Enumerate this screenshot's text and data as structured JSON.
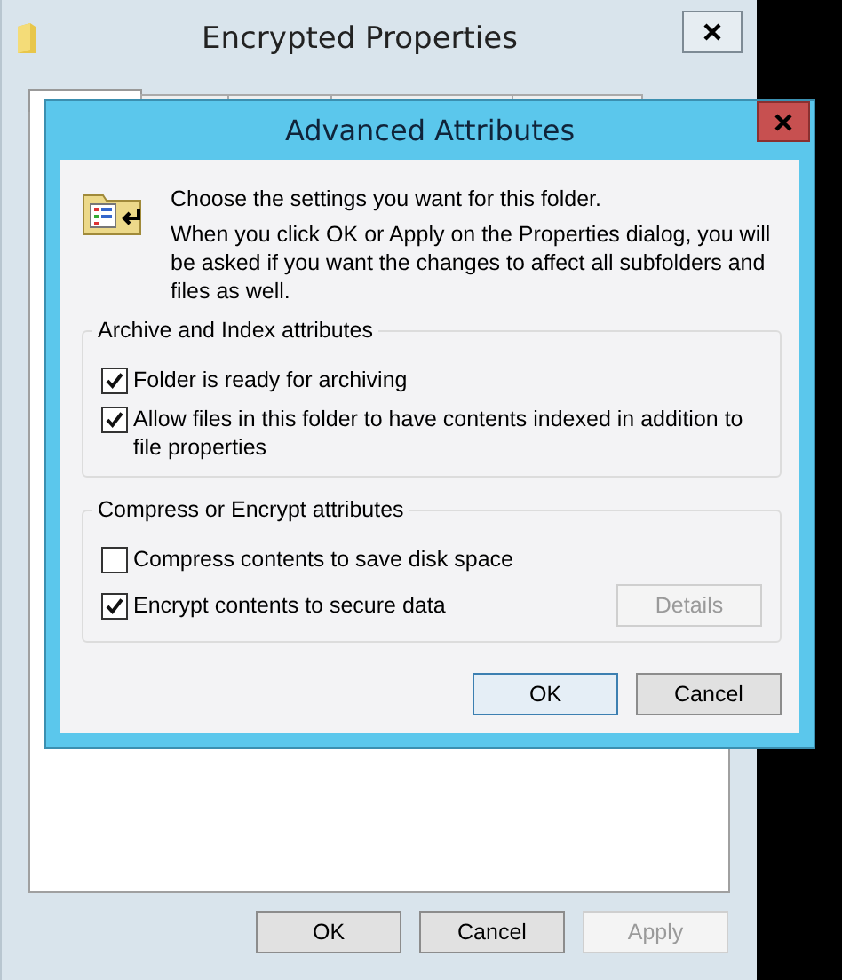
{
  "back_window": {
    "title": "Encrypted Properties",
    "buttons": [
      {
        "label": "OK",
        "disabled": false
      },
      {
        "label": "Cancel",
        "disabled": false
      },
      {
        "label": "Apply",
        "disabled": true
      }
    ]
  },
  "dialog": {
    "title": "Advanced Attributes",
    "intro": "Choose the settings you want for this folder.",
    "note": "When you click OK or Apply on the Properties dialog, you will be asked if you want the changes to affect all subfolders and files as well.",
    "groups": [
      {
        "title": "Archive and Index attributes",
        "options": [
          {
            "label": "Folder is ready for archiving",
            "checked": true
          },
          {
            "label": "Allow files in this folder to have contents indexed in addition to file properties",
            "checked": true
          }
        ]
      },
      {
        "title": "Compress or Encrypt attributes",
        "options": [
          {
            "label": "Compress contents to save disk space",
            "checked": false
          },
          {
            "label": "Encrypt contents to secure data",
            "checked": true,
            "button": {
              "label": "Details",
              "disabled": true
            }
          }
        ]
      }
    ],
    "buttons": [
      {
        "label": "OK",
        "default": true
      },
      {
        "label": "Cancel",
        "default": false
      }
    ]
  }
}
